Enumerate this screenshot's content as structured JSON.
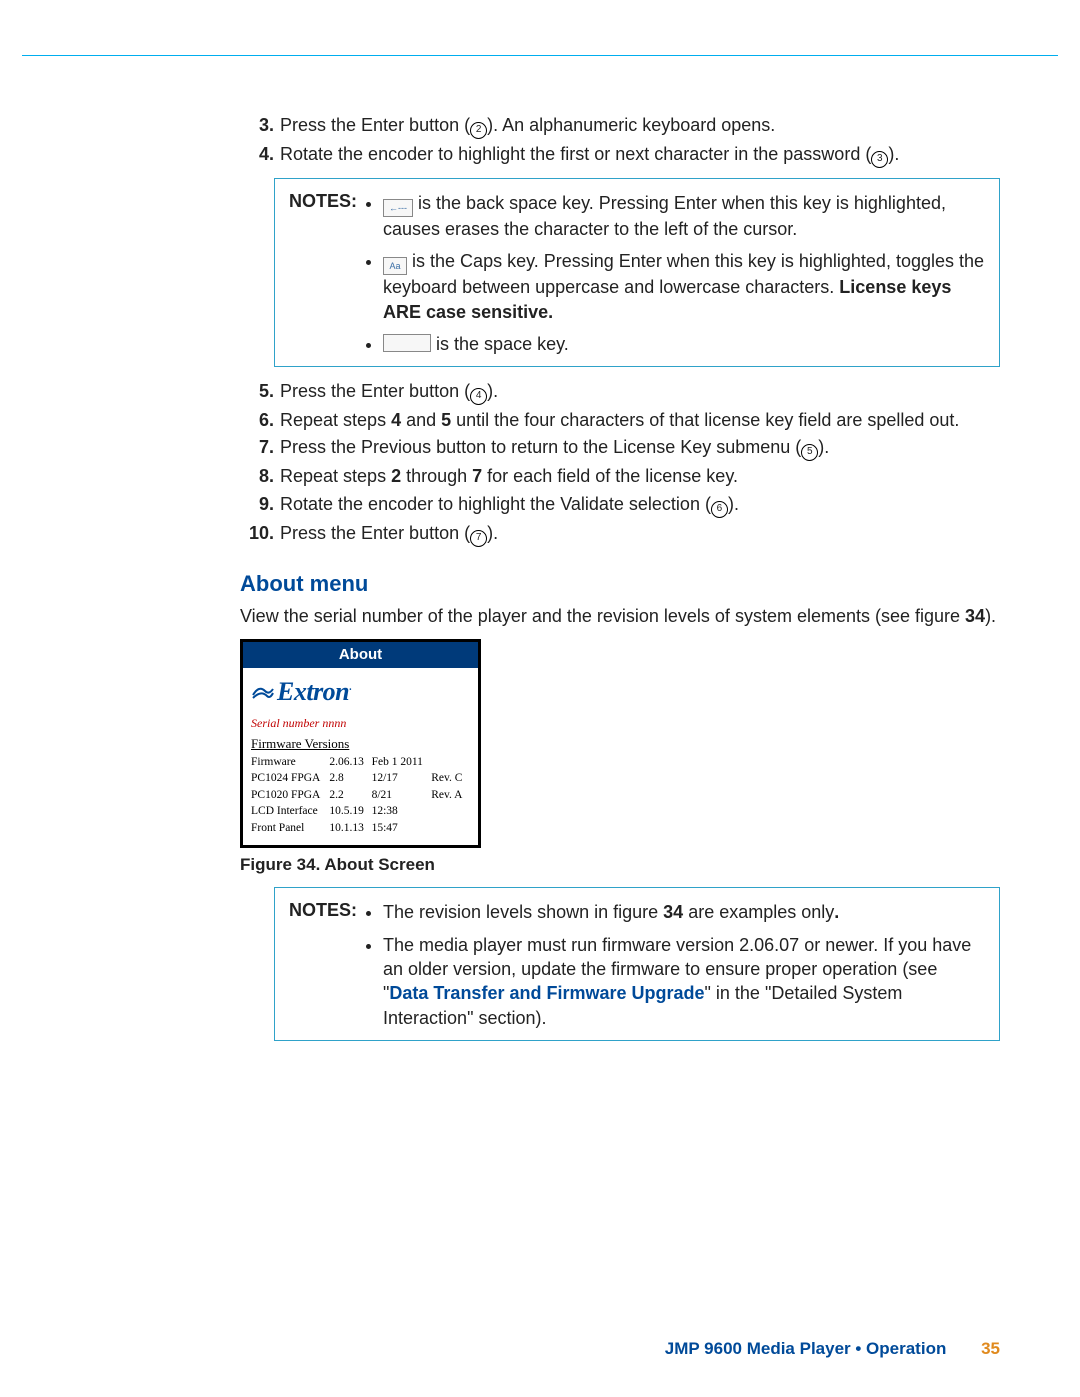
{
  "steps_top": [
    {
      "n": "3.",
      "html": "Press the Enter button (②). An alphanumeric keyboard opens."
    },
    {
      "n": "4.",
      "html": "Rotate the encoder to highlight the first or next character in the password (③)."
    }
  ],
  "notes1": {
    "label": "NOTES:",
    "items": [
      "is the back space key. Pressing Enter when this key is highlighted, causes erases the character to the left of the cursor.",
      "is the Caps key. Pressing Enter when this key is highlighted, toggles the keyboard between uppercase and lowercase characters. ",
      "is the space key."
    ],
    "license_bold": "License keys ARE case sensitive.",
    "caps_label": "Aa",
    "back_label": "←---"
  },
  "steps_mid": [
    {
      "n": "5.",
      "html": "Press the Enter button (④)."
    },
    {
      "n": "6.",
      "html": "Repeat steps <b class='doc-bold'>4</b> and <b class='doc-bold'>5</b> until the four characters of that license key field are spelled out."
    },
    {
      "n": "7.",
      "html": "Press the Previous button to return to the License Key submenu (⑤)."
    },
    {
      "n": "8.",
      "html": "Repeat steps <b class='doc-bold'>2</b> through <b class='doc-bold'>7</b> for each field of the license key."
    },
    {
      "n": "9.",
      "html": "Rotate the encoder to highlight the Validate selection (⑥)."
    },
    {
      "n": "10.",
      "html": "Press the Enter button (⑦)."
    }
  ],
  "about_heading": "About menu",
  "about_intro_pre": "View the serial number of the player and the revision levels of system elements (see figure ",
  "about_intro_ref": "34",
  "about_intro_post": ").",
  "about_screen": {
    "title": "About",
    "logo": "Extron",
    "serial": "Serial number  nnnn",
    "fv_header": "Firmware Versions",
    "rows": [
      [
        "Firmware",
        "2.06.13",
        "Feb 1 2011",
        ""
      ],
      [
        "PC1024 FPGA",
        "2.8",
        "12/17",
        "Rev. C"
      ],
      [
        "PC1020 FPGA",
        "2.2",
        "8/21",
        "Rev. A"
      ],
      [
        "LCD Interface",
        "10.5.19",
        "12:38",
        ""
      ],
      [
        "Front Panel",
        "10.1.13",
        "15:47",
        ""
      ]
    ]
  },
  "fig_caption": "Figure 34. About Screen",
  "notes2": {
    "label": "NOTES:",
    "items": [
      {
        "pre": "The revision levels shown in figure ",
        "ref": "34",
        "post": " are examples only",
        "tail": "."
      },
      {
        "text": "The media player must run firmware version 2.06.07 or newer. If you have an older version, update the firmware to ensure proper operation (see \"",
        "link": "Data Transfer and Firmware Upgrade",
        "after": "\" in the \"Detailed System Interaction\" section)."
      }
    ]
  },
  "footer": {
    "title": "JMP 9600 Media Player • Operation",
    "page": "35"
  }
}
